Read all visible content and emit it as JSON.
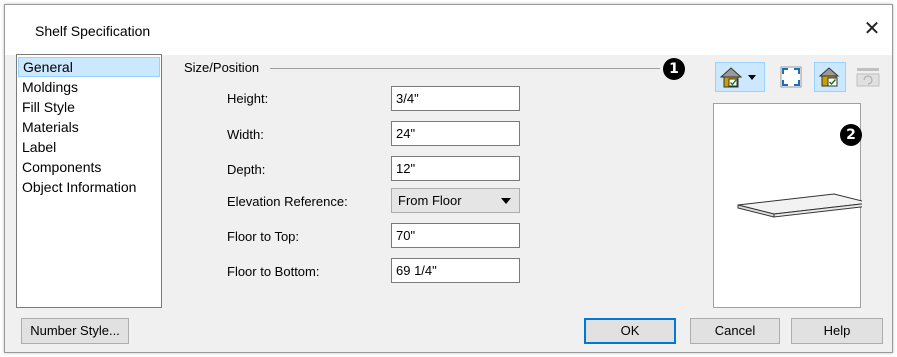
{
  "window": {
    "title": "Shelf Specification",
    "close_glyph": "✕"
  },
  "sidebar": {
    "items": [
      {
        "label": "General",
        "selected": true
      },
      {
        "label": "Moldings"
      },
      {
        "label": "Fill Style"
      },
      {
        "label": "Materials"
      },
      {
        "label": "Label"
      },
      {
        "label": "Components"
      },
      {
        "label": "Object Information"
      }
    ]
  },
  "section": {
    "title": "Size/Position",
    "callout": "1"
  },
  "fields": {
    "height": {
      "label": "Height:",
      "value": "3/4\""
    },
    "width": {
      "label": "Width:",
      "value": "24\""
    },
    "depth": {
      "label": "Depth:",
      "value": "12\""
    },
    "elevation_reference": {
      "label": "Elevation Reference:",
      "value": "From Floor"
    },
    "floor_to_top": {
      "label": "Floor to Top:",
      "value": "70\""
    },
    "floor_to_bottom": {
      "label": "Floor to Bottom:",
      "value": "69 1/4\""
    }
  },
  "preview": {
    "callout": "2",
    "toolbar_icons": [
      "view-type-dropdown-icon",
      "fill-window-icon",
      "color-toggle-icon",
      "refresh-icon"
    ]
  },
  "buttons": {
    "number_style": "Number Style...",
    "ok": "OK",
    "cancel": "Cancel",
    "help": "Help"
  },
  "colors": {
    "accent": "#0078d7",
    "selection": "#cce8ff",
    "dialog_bg": "#f0f0f0"
  }
}
